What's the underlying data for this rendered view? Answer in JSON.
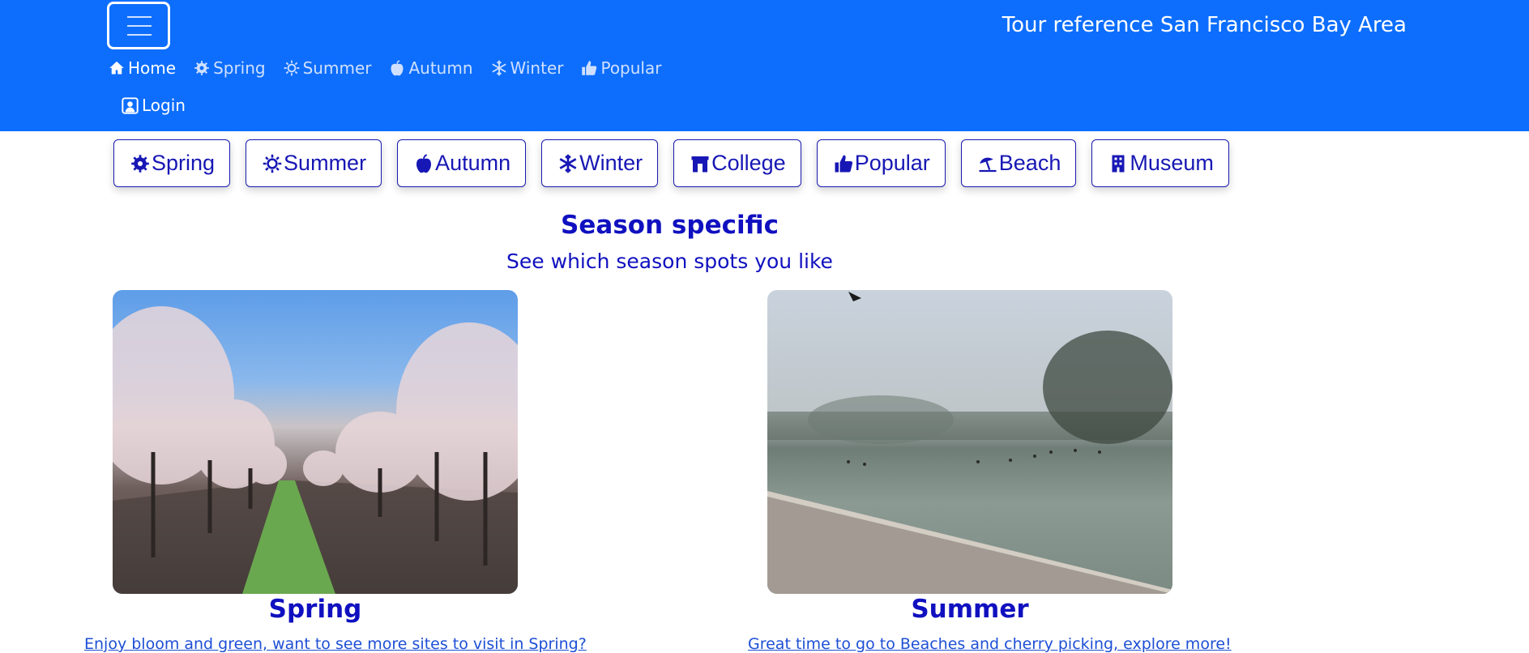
{
  "navbar": {
    "brand": "Tour reference San Francisco Bay Area",
    "toggler_icon": "menu-icon",
    "links": [
      {
        "label": "Home",
        "icon": "home-icon",
        "active": true
      },
      {
        "label": "Spring",
        "icon": "gear-flower-icon",
        "active": false
      },
      {
        "label": "Summer",
        "icon": "sun-icon",
        "active": false
      },
      {
        "label": "Autumn",
        "icon": "apple-icon",
        "active": false
      },
      {
        "label": "Winter",
        "icon": "snowflake-icon",
        "active": false
      },
      {
        "label": "Popular",
        "icon": "thumbs-up-icon",
        "active": false
      }
    ],
    "login": {
      "label": "Login",
      "icon": "person-badge-icon"
    }
  },
  "categories": [
    {
      "label": "Spring",
      "icon": "gear-flower-icon"
    },
    {
      "label": "Summer",
      "icon": "sun-icon"
    },
    {
      "label": "Autumn",
      "icon": "apple-icon"
    },
    {
      "label": "Winter",
      "icon": "snowflake-icon"
    },
    {
      "label": "College",
      "icon": "building-gate-icon"
    },
    {
      "label": "Popular",
      "icon": "thumbs-up-icon"
    },
    {
      "label": "Beach",
      "icon": "umbrella-icon"
    },
    {
      "label": "Museum",
      "icon": "building-icon"
    }
  ],
  "section": {
    "title": "Season specific",
    "subtitle": "See which season spots you like"
  },
  "cards": [
    {
      "title": "Spring",
      "link": "Enjoy bloom and green, want to see more sites to visit in Spring?"
    },
    {
      "title": "Summer",
      "link": "Great time to go to Beaches and cherry picking, explore more!"
    }
  ],
  "colors": {
    "navbar": "#0d6efd",
    "accent_text": "#1010c0",
    "link": "#1d4fd6"
  }
}
